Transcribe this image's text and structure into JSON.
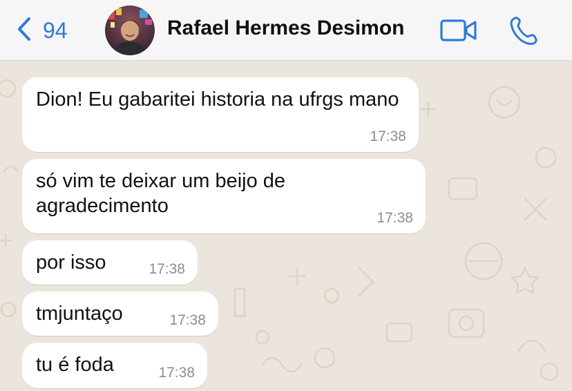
{
  "header": {
    "back_count": "94",
    "contact_name": "Rafael Hermes Desimon"
  },
  "colors": {
    "accent": "#2f7ad8",
    "header_bg": "#f6f6f6",
    "chat_bg": "#ece5dd",
    "bubble_bg": "#ffffff",
    "time_text": "#8c8c8c"
  },
  "icons": {
    "back": "chevron-left-icon",
    "video": "video-camera-icon",
    "call": "phone-icon"
  },
  "messages": [
    {
      "text": "Dion! Eu gabaritei historia na ufrgs mano",
      "time": "17:38"
    },
    {
      "text": "só vim te deixar um beijo de agradecimento",
      "time": "17:38"
    },
    {
      "text": "por isso",
      "time": "17:38"
    },
    {
      "text": "tmjuntaço",
      "time": "17:38"
    },
    {
      "text": "tu é foda",
      "time": "17:38"
    }
  ]
}
